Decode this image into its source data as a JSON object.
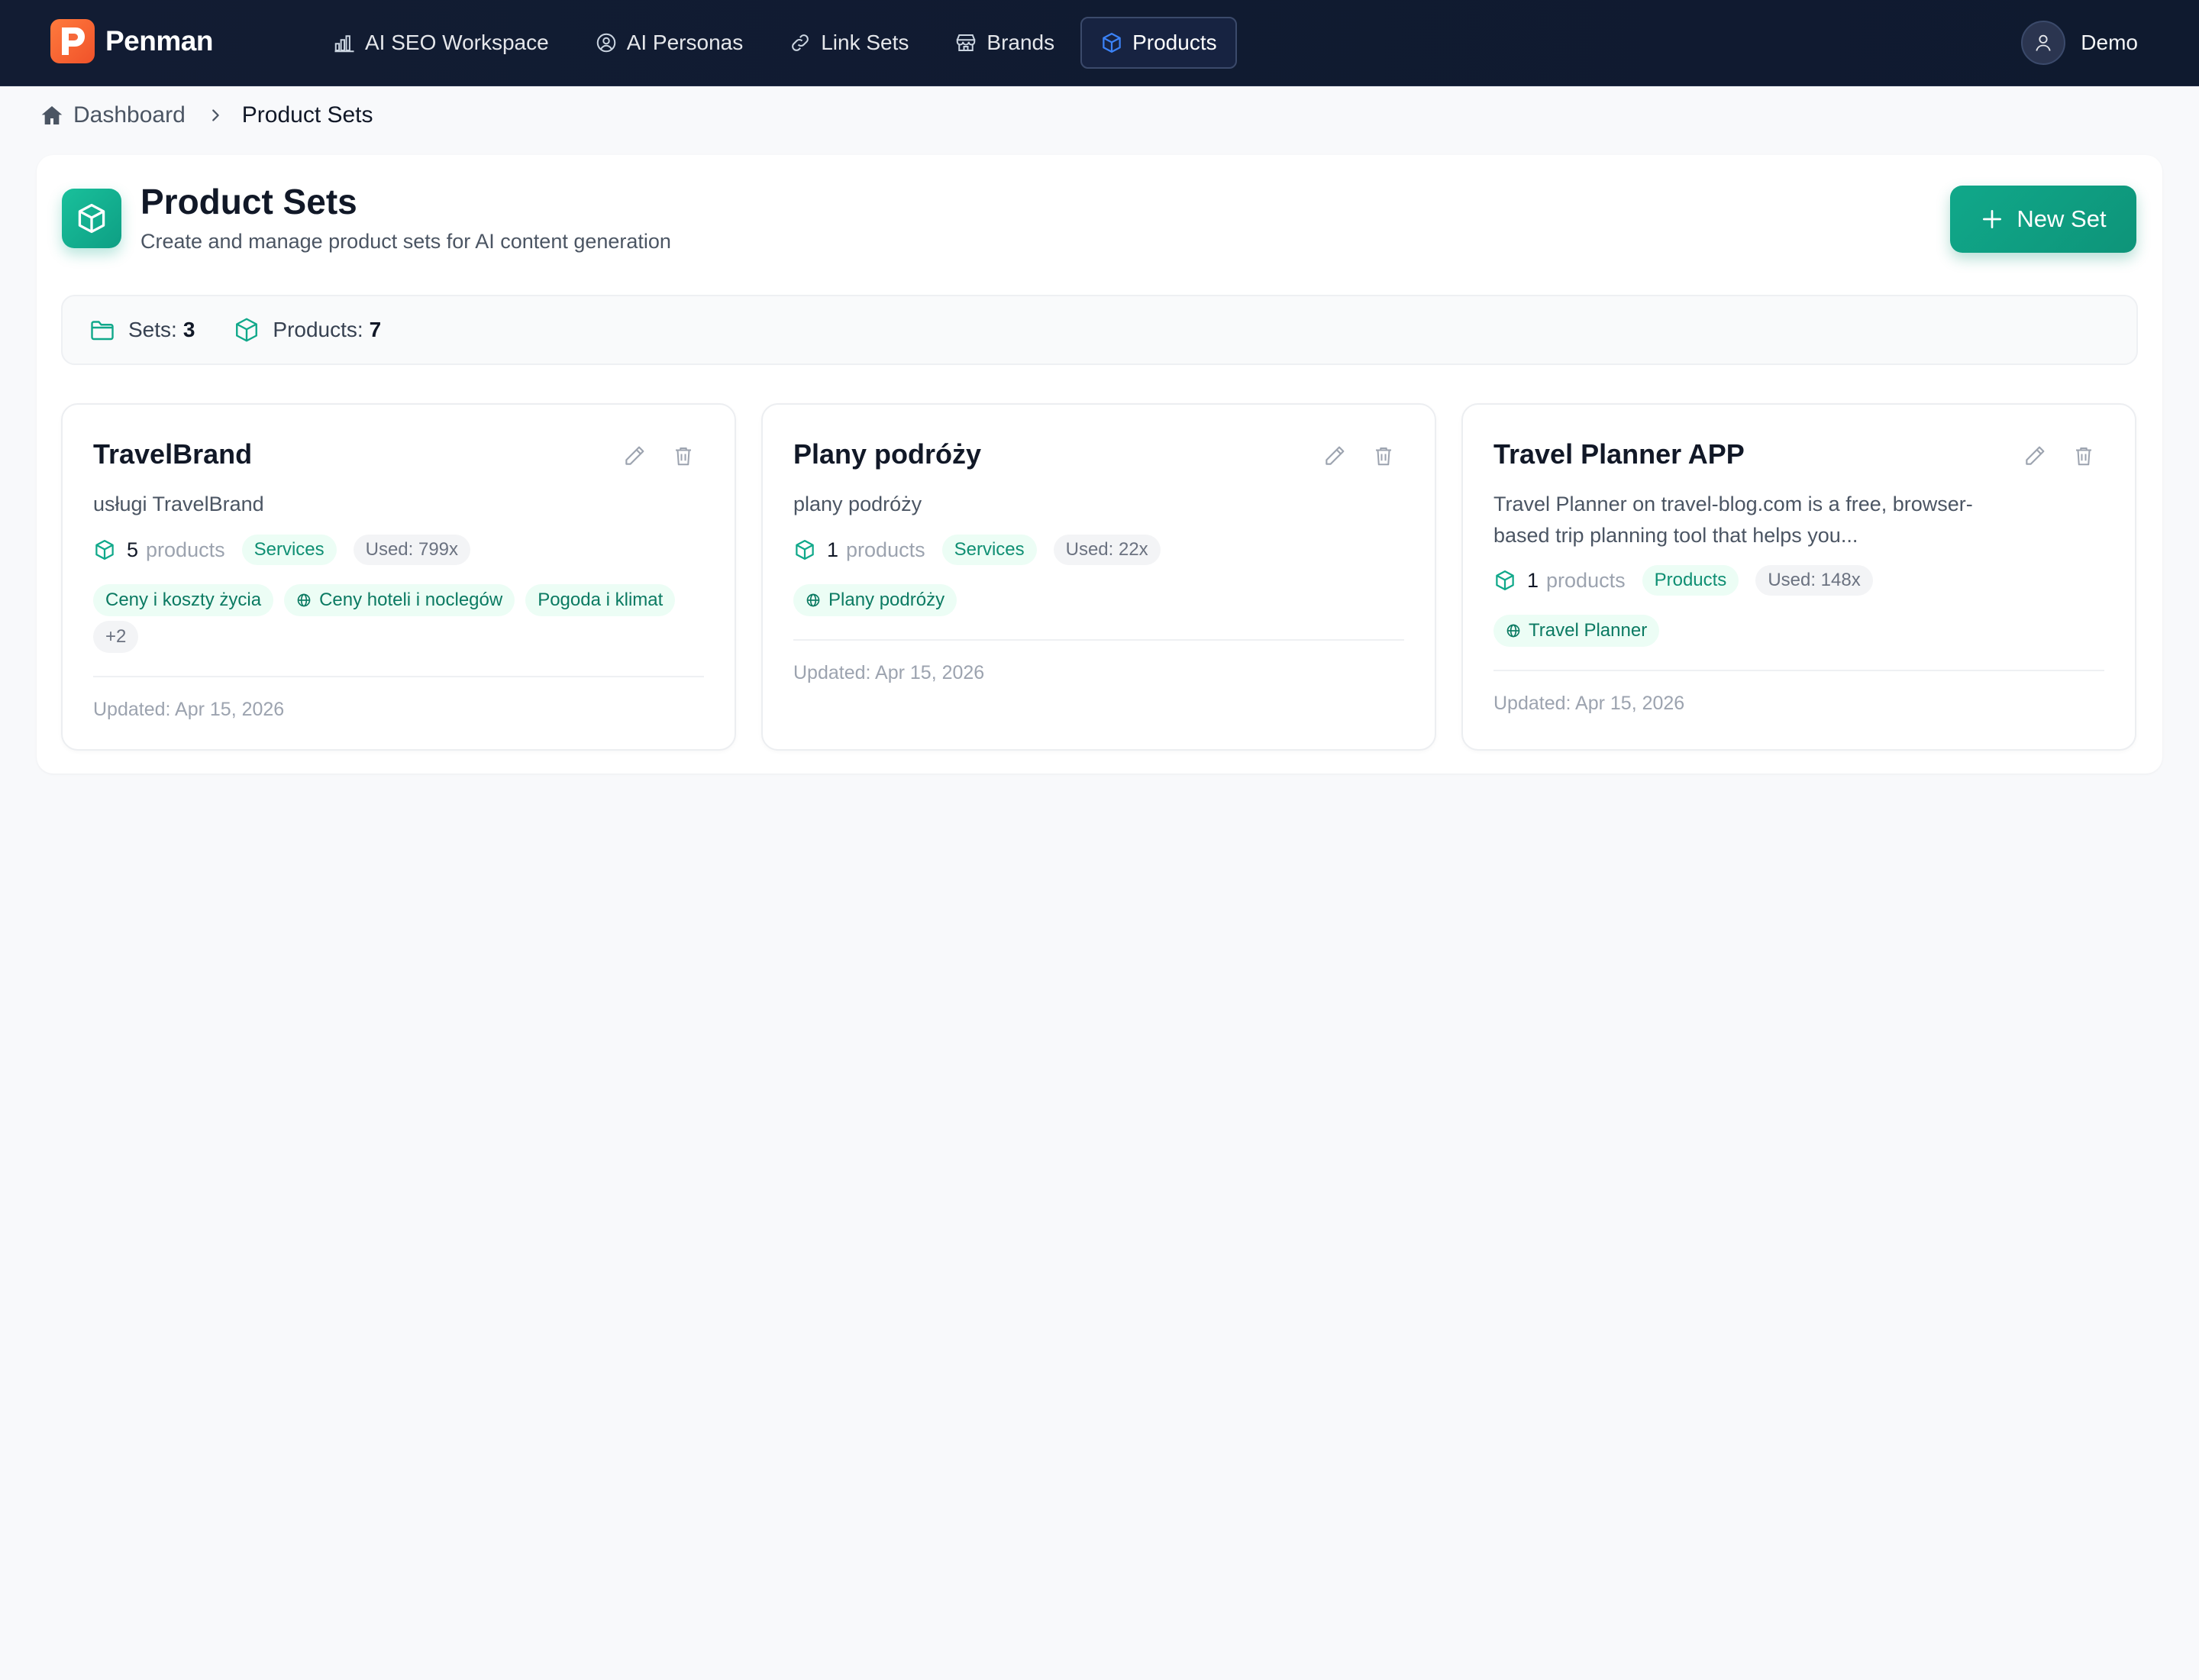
{
  "app": {
    "name": "Penman"
  },
  "nav": {
    "items": [
      {
        "label": "AI SEO Workspace",
        "icon": "bar-chart-icon"
      },
      {
        "label": "AI Personas",
        "icon": "user-circle-icon"
      },
      {
        "label": "Link Sets",
        "icon": "link-icon"
      },
      {
        "label": "Brands",
        "icon": "store-icon"
      },
      {
        "label": "Products",
        "icon": "cube-icon",
        "active": true
      }
    ],
    "user": "Demo"
  },
  "breadcrumb": {
    "home": "Dashboard",
    "current": "Product Sets"
  },
  "header": {
    "title": "Product Sets",
    "subtitle": "Create and manage product sets for AI content generation",
    "new_button": "New Set"
  },
  "stats": {
    "sets_label": "Sets:",
    "sets_value": "3",
    "products_label": "Products:",
    "products_value": "7"
  },
  "cards": [
    {
      "title": "TravelBrand",
      "description": "usługi TravelBrand",
      "count": "5",
      "count_unit": "products",
      "type": "Services",
      "used": "Used: 799x",
      "tags": [
        "Ceny i koszty życia",
        "Ceny hoteli i noclegów",
        "Pogoda i klimat"
      ],
      "more": "+2",
      "updated": "Updated: Apr 15, 2026"
    },
    {
      "title": "Plany podróży",
      "description": "plany podróży",
      "count": "1",
      "count_unit": "products",
      "type": "Services",
      "used": "Used: 22x",
      "tags": [
        "Plany podróży"
      ],
      "updated": "Updated: Apr 15, 2026"
    },
    {
      "title": "Travel Planner APP",
      "description": "Travel Planner on travel-blog.com is a free, browser-based trip planning tool that helps you...",
      "count": "1",
      "count_unit": "products",
      "type": "Products",
      "used": "Used: 148x",
      "tags": [
        "Travel Planner"
      ],
      "updated": "Updated: Apr 15, 2026"
    }
  ],
  "colors": {
    "accent": "#10a88a",
    "nav_bg": "#121c33",
    "logo": "#f0522a"
  }
}
